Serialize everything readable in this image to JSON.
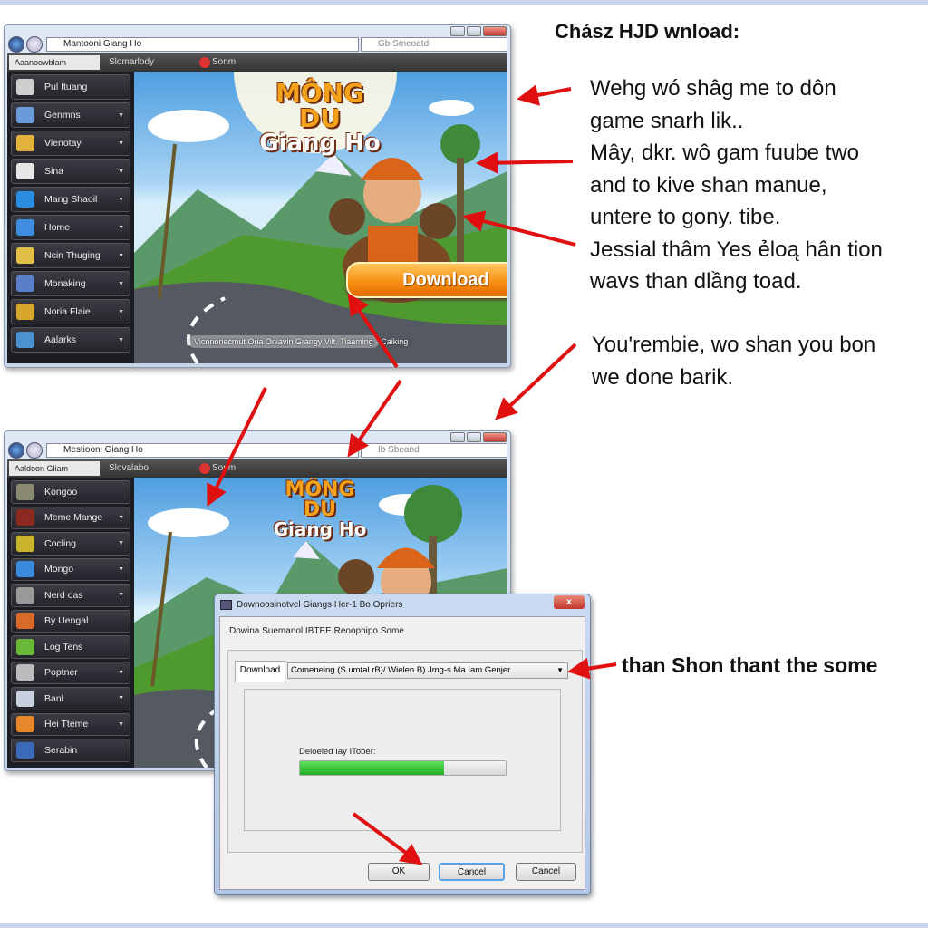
{
  "heading": "Chász HJD wnload:",
  "paragraph1": [
    "Wehg wó shâg me to dôn",
    "game snarh lik..",
    "Mây, dkr. wô gam fuube two",
    "and to  kive shan manue,",
    "untere to gony. tibe.",
    "Jessial thâm  Yes ẻloą hân tion",
    "wavs than dlầng toad."
  ],
  "paragraph2": [
    "You'rembie, wo shan you bon",
    "we done barik."
  ],
  "callout": "than Shon thant the some",
  "window1": {
    "address": "Mantooni Giang Ho",
    "search_placeholder": "Gb Smeoatd",
    "tabs": [
      "Aaanoowblam",
      "Slomarlody",
      "Sonm"
    ],
    "sidebar": [
      {
        "label": "Pul Ituang",
        "icon": "search-icon",
        "color": "#cfcfcf",
        "arrow": false
      },
      {
        "label": "Genmns",
        "icon": "mail-icon",
        "color": "#6a9bd8",
        "arrow": true
      },
      {
        "label": "Vienotay",
        "icon": "star-icon",
        "color": "#e2b23c",
        "arrow": true
      },
      {
        "label": "Sina",
        "icon": "envelope-icon",
        "color": "#e6e6e6",
        "arrow": true
      },
      {
        "label": "Mang Shaoil",
        "icon": "chat-icon",
        "color": "#2a8de0",
        "arrow": true
      },
      {
        "label": "Home",
        "icon": "gem-icon",
        "color": "#3f8de0",
        "arrow": true
      },
      {
        "label": "Ncin Thuging",
        "icon": "character-icon",
        "color": "#e2c048",
        "arrow": true
      },
      {
        "label": "Monaking",
        "icon": "gate-icon",
        "color": "#5a7fc8",
        "arrow": true
      },
      {
        "label": "Noria Flaie",
        "icon": "gold-icon",
        "color": "#d7a62a",
        "arrow": true
      },
      {
        "label": "Aalarks",
        "icon": "frame-icon",
        "color": "#4b93d0",
        "arrow": true
      }
    ],
    "logo": {
      "line1": "MÔNG DU",
      "line2": "Giang Ho"
    },
    "download_button": "Download",
    "caption": "Vicnnoriecmut Oria Oniavin Grangy Vilt. Tiaaming",
    "caption_right": "Caiking"
  },
  "window2": {
    "address": "Mestiooni Giang Ho",
    "search_placeholder": "Ib Sbeand",
    "tabs": [
      "Aaldoon Gliam",
      "Slovalabo",
      "Sonm"
    ],
    "sidebar": [
      {
        "label": "Kongoo",
        "icon": "chest-icon",
        "color": "#8a8a70",
        "arrow": false
      },
      {
        "label": "Meme Mange",
        "icon": "warrior-icon",
        "color": "#8a2a20",
        "arrow": true
      },
      {
        "label": "Cocling",
        "icon": "map-icon",
        "color": "#c9b32a",
        "arrow": true
      },
      {
        "label": "Mongo",
        "icon": "butterfly-icon",
        "color": "#3a8ae0",
        "arrow": true
      },
      {
        "label": "Nerd oas",
        "icon": "rock-icon",
        "color": "#9a9a9a",
        "arrow": true
      },
      {
        "label": "By Uengal",
        "icon": "bird-icon",
        "color": "#d86a2a",
        "arrow": false
      },
      {
        "label": "Log Tens",
        "icon": "dragon-icon",
        "color": "#6ab83a",
        "arrow": false
      },
      {
        "label": "Poptner",
        "icon": "swords-icon",
        "color": "#bbbbbb",
        "arrow": true
      },
      {
        "label": "Banl",
        "icon": "book-icon",
        "color": "#c8d0e0",
        "arrow": true
      },
      {
        "label": "Hei Tteme",
        "icon": "basket-icon",
        "color": "#e8862a",
        "arrow": true
      },
      {
        "label": "Serabin",
        "icon": "figure-icon",
        "color": "#3a6ab8",
        "arrow": false
      }
    ],
    "logo": {
      "line1": "MÔNG DU",
      "line2": "Giang Ho"
    }
  },
  "dialog": {
    "title": "Downoosinotvel Giangs Her-1 Bo Opriers",
    "heading": "Dowina Suemanol IBTEE Reoophipo Some",
    "tab": "Download",
    "dropdown_value": "Comeneing (S.umtal rB)/ Wielen B) Jmg-s Ma Iam Genjer",
    "progress_label": "Deloeled Iay ITober:",
    "progress_percent": 70,
    "buttons": [
      "OK",
      "Cancel",
      "Cancel"
    ],
    "close": "x"
  },
  "colors": {
    "arrow": "#e01010",
    "progress": "#2ec22e",
    "accent": "#f78b10"
  }
}
